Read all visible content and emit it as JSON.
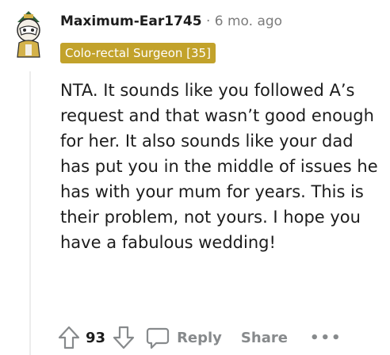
{
  "comment": {
    "username": "Maximum-Ear1745",
    "separator": "·",
    "age": "6 mo. ago",
    "flair": "Colo-rectal Surgeon [35]",
    "body": "NTA. It sounds like you followed A’s request and that wasn’t good enough for her. It also sounds like your dad has put you in the middle of issues he has with your mum for years. This is their problem, not yours. I hope you have a fabulous wedding!",
    "vote_count": "93",
    "reply_label": "Reply",
    "share_label": "Share",
    "more_label": "•••"
  },
  "colors": {
    "flair_bg": "#c2a22b",
    "meta_gray": "#7c7c7c",
    "action_gray": "#878a8c",
    "text": "#1c1c1c"
  },
  "icons": [
    "avatar",
    "upvote-icon",
    "downvote-icon",
    "reply-icon",
    "more-icon"
  ]
}
